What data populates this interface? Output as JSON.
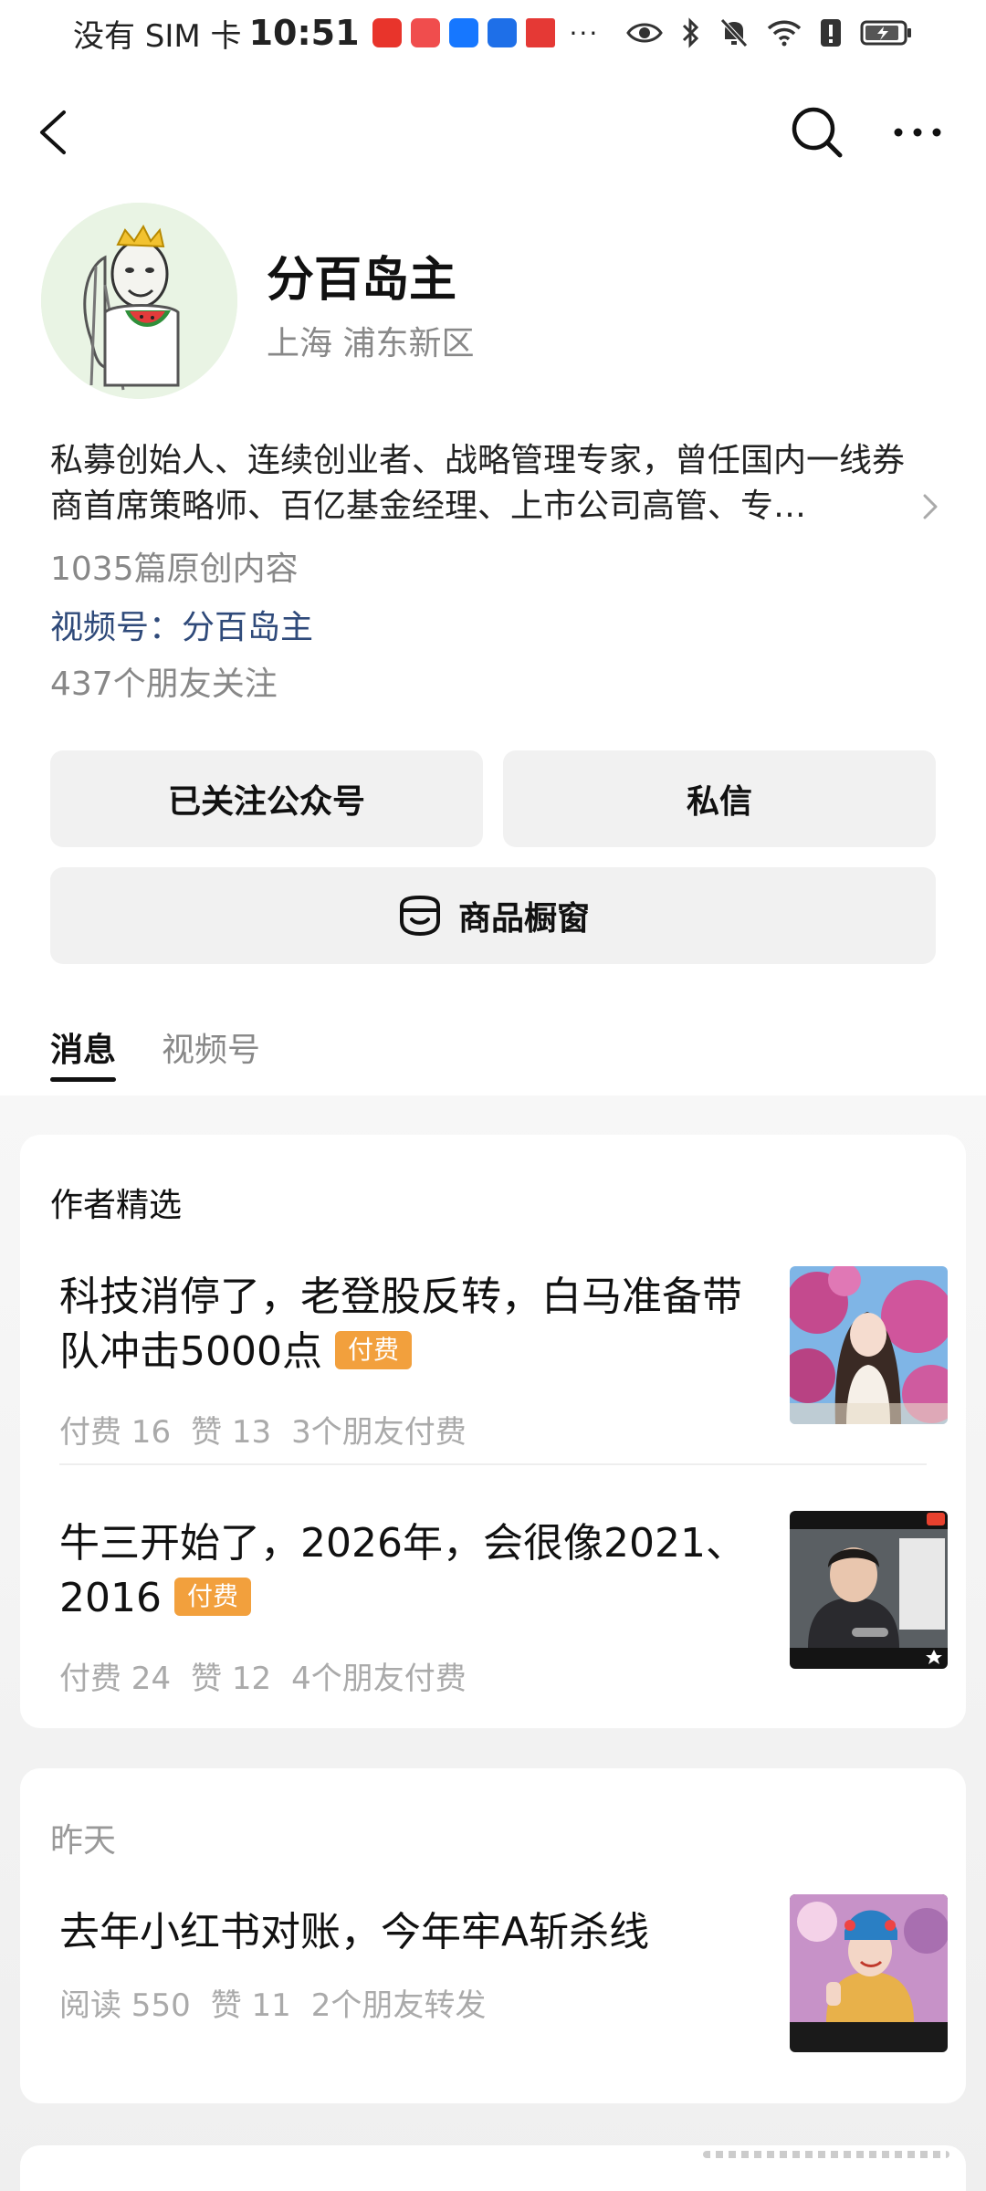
{
  "status_bar": {
    "carrier": "没有 SIM 卡",
    "time": "10:51",
    "overflow": "···",
    "app_icons": [
      {
        "name": "video-app-icon",
        "color": "#e8342b"
      },
      {
        "name": "shopping-app-icon",
        "color": "#f04d4d"
      },
      {
        "name": "alipay-icon",
        "color": "#1677ff"
      },
      {
        "name": "lightbulb-app-icon",
        "color": "#1e6fe8"
      },
      {
        "name": "book-app-icon",
        "color": "#e53935"
      }
    ]
  },
  "profile": {
    "name": "分百岛主",
    "location": "上海 浦东新区",
    "bio": "私募创始人、连续创业者、战略管理专家，曾任国内一线券商首席策略师、百亿基金经理、上市公司高管、专…",
    "original_count": "1035篇原创内容",
    "channel": "视频号：分百岛主",
    "friends_following": "437个朋友关注"
  },
  "actions": {
    "follow_label": "已关注公众号",
    "message_label": "私信",
    "shop_label": "商品橱窗"
  },
  "tabs": [
    {
      "label": "消息",
      "active": true
    },
    {
      "label": "视频号",
      "active": false
    }
  ],
  "featured": {
    "heading": "作者精选",
    "articles": [
      {
        "title": "科技消停了，老登股反转，白马准备带队冲击5000点",
        "badge": "付费",
        "meta": [
          "付费 16",
          "赞 13",
          "3个朋友付费"
        ]
      },
      {
        "title": "牛三开始了，2026年，会很像2021、2016",
        "badge": "付费",
        "meta": [
          "付费 24",
          "赞 12",
          "4个朋友付费"
        ]
      }
    ]
  },
  "yesterday": {
    "heading": "昨天",
    "articles": [
      {
        "title": "去年小红书对账，今年牢A斩杀线",
        "meta": [
          "阅读 550",
          "赞 11",
          "2个朋友转发"
        ]
      }
    ]
  },
  "colors": {
    "badge": "#f2a03d",
    "link": "#2f4a7a",
    "button_bg": "#f1f1f1"
  }
}
